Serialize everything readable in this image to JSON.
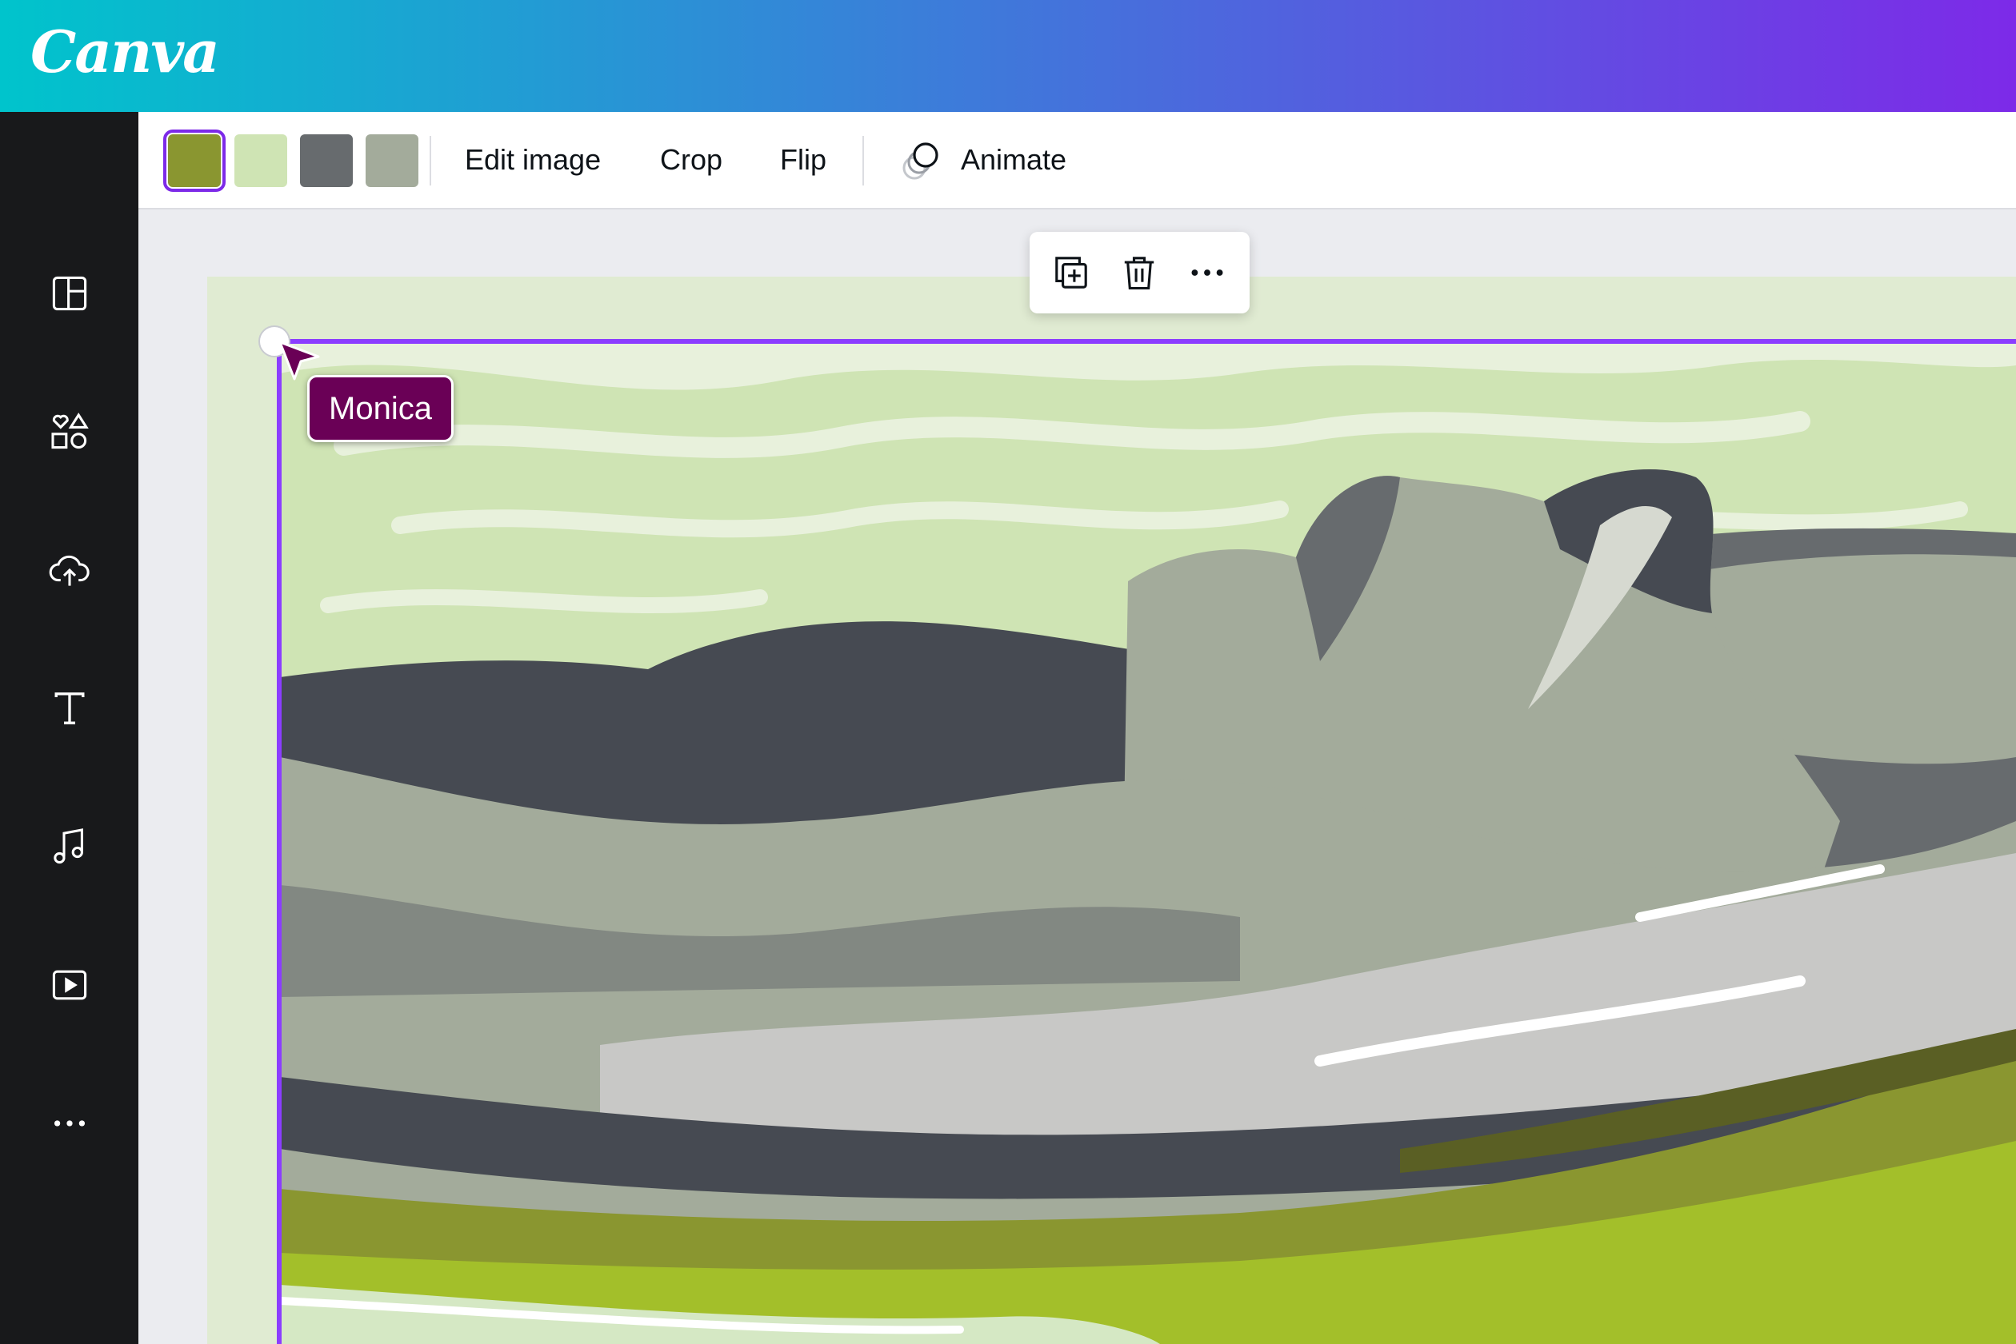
{
  "app": {
    "logo_text": "Canva"
  },
  "sidebar": {
    "items": [
      {
        "icon": "layout-icon"
      },
      {
        "icon": "elements-icon"
      },
      {
        "icon": "upload-cloud-icon"
      },
      {
        "icon": "text-icon"
      },
      {
        "icon": "music-icon"
      },
      {
        "icon": "video-icon"
      },
      {
        "icon": "more-icon"
      }
    ]
  },
  "toolbar": {
    "swatches": [
      "#8a9630",
      "#cfe4b4",
      "#676b6e",
      "#a3ab9b"
    ],
    "selected_swatch": 0,
    "edit_image_label": "Edit image",
    "crop_label": "Crop",
    "flip_label": "Flip",
    "animate_label": "Animate"
  },
  "floating_toolbar": {
    "icons": [
      "duplicate-icon",
      "trash-icon",
      "more-options-icon"
    ]
  },
  "collaborator": {
    "name": "Monica",
    "color": "#6a0056"
  },
  "colors": {
    "accent": "#8b3dff",
    "page_bg": "#e0ebd2",
    "sky": "#cfe4b4"
  }
}
